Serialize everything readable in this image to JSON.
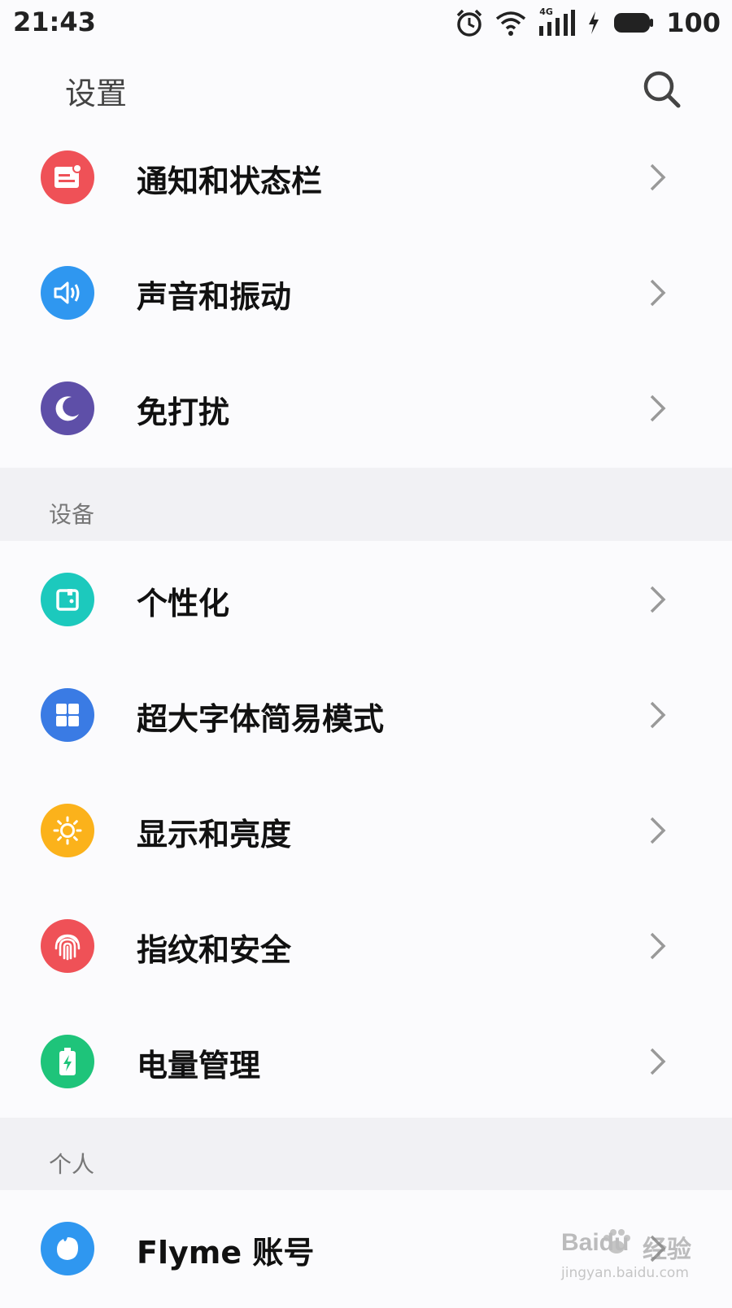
{
  "status_bar": {
    "time": "21:43",
    "network_label": "4G",
    "battery": "100",
    "icons": [
      "alarm-icon",
      "wifi-icon",
      "signal-icon",
      "charging-icon",
      "battery-icon"
    ]
  },
  "header": {
    "title": "设置",
    "search_icon": "search-icon"
  },
  "groups": {
    "top": [
      {
        "label": "通知和状态栏",
        "icon": "notification-icon",
        "color": "#ef5157"
      },
      {
        "label": "声音和振动",
        "icon": "volume-icon",
        "color": "#2f97f0"
      },
      {
        "label": "免打扰",
        "icon": "moon-icon",
        "color": "#5e4fa8"
      }
    ],
    "device": {
      "title": "设备",
      "items": [
        {
          "label": "个性化",
          "icon": "personalize-icon",
          "color": "#1cc9bd"
        },
        {
          "label": "超大字体简易模式",
          "icon": "grid-icon",
          "color": "#3a7be4"
        },
        {
          "label": "显示和亮度",
          "icon": "brightness-icon",
          "color": "#fbb21b"
        },
        {
          "label": "指纹和安全",
          "icon": "fingerprint-icon",
          "color": "#ef5157"
        },
        {
          "label": "电量管理",
          "icon": "battery-saver-icon",
          "color": "#1ec47a"
        }
      ]
    },
    "personal": {
      "title": "个人",
      "items": [
        {
          "label": "Flyme 账号",
          "icon": "account-icon",
          "color": "#2f97f0"
        }
      ]
    }
  },
  "watermark": {
    "brand": "Baidu",
    "text": "经验",
    "url": "jingyan.baidu.com"
  }
}
